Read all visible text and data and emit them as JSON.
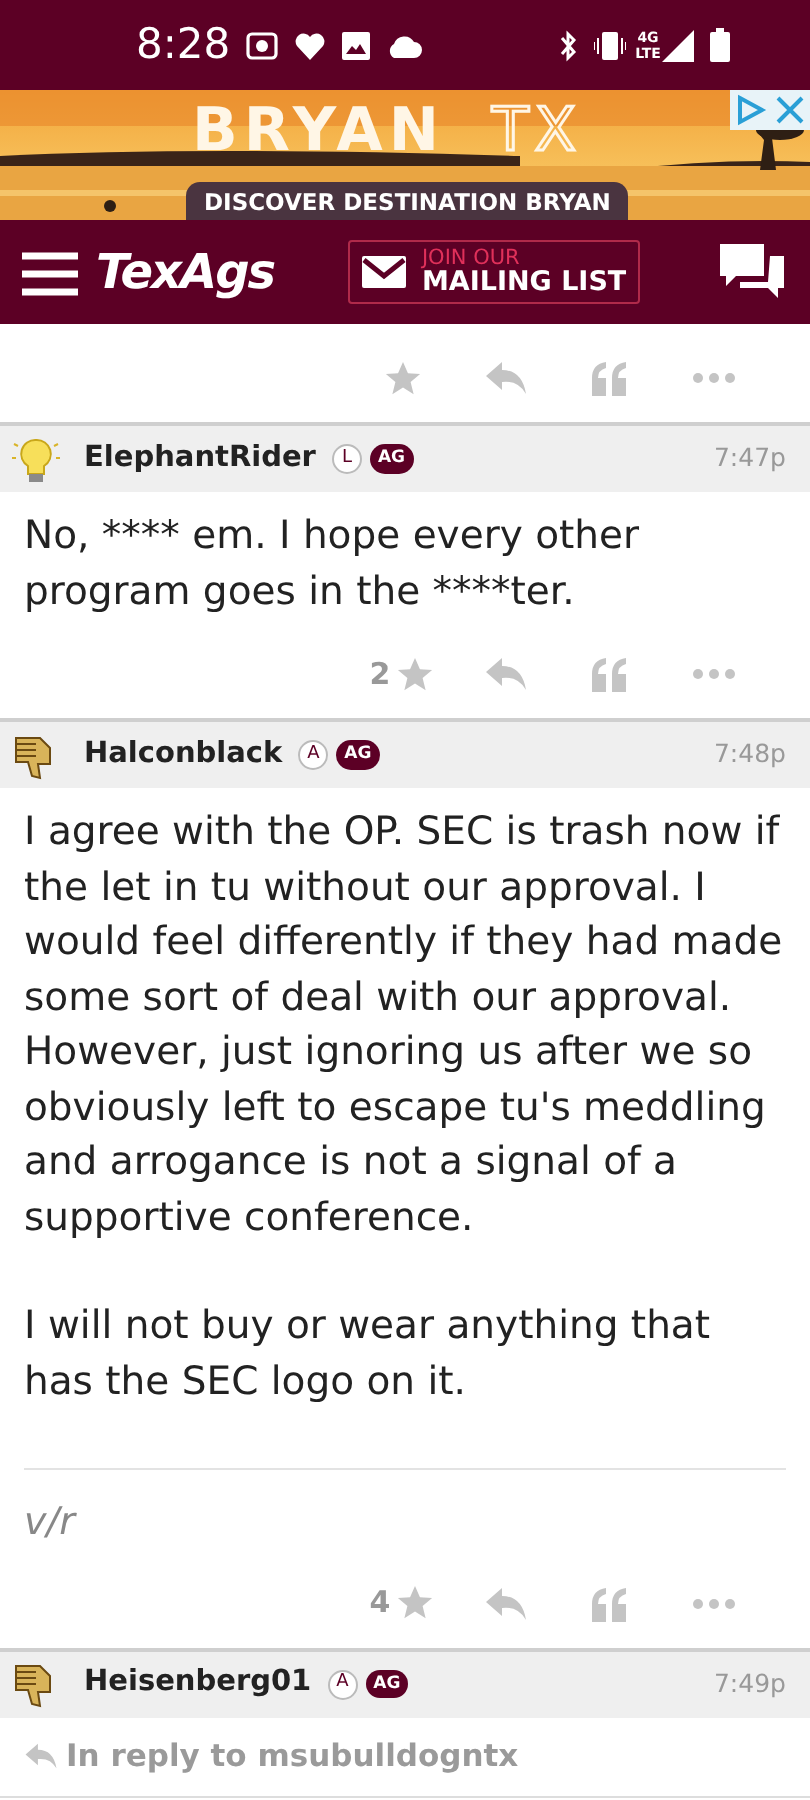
{
  "status_bar": {
    "time": "8:28",
    "network": "4G LTE"
  },
  "ad": {
    "headline": "BRYAN",
    "headline_suffix": "TX",
    "tagline": "DISCOVER DESTINATION BRYAN"
  },
  "navbar": {
    "logo": "TexAgs",
    "mailing_top": "JOIN OUR",
    "mailing_bottom": "MAILING LIST"
  },
  "posts": [
    {
      "username": "ElephantRider",
      "avatar": {
        "kind": "lightbulb"
      },
      "badges": [
        {
          "label": "L",
          "kind": "rank"
        },
        {
          "label": "AG",
          "kind": "school"
        }
      ],
      "time": "7:47p",
      "paragraphs": [
        "No, **** em. I hope every other program goes in the ****ter."
      ],
      "star_count": "2"
    },
    {
      "username": "Halconblack",
      "avatar": {
        "kind": "thumbsdown"
      },
      "badges": [
        {
          "label": "A",
          "kind": "rank"
        },
        {
          "label": "AG",
          "kind": "school"
        }
      ],
      "time": "7:48p",
      "paragraphs": [
        "I agree with the OP. SEC is trash now if the let in tu without our approval. I would feel differently if they had made some sort of deal with our approval. However, just ignoring us after we so obviously left to escape tu's meddling and arrogance is not a signal of a supportive conference.",
        "I will not buy or wear anything that has the SEC logo on it."
      ],
      "signature": "v/r",
      "star_count": "4"
    },
    {
      "username": "Heisenberg01",
      "avatar": {
        "kind": "thumbsdown"
      },
      "badges": [
        {
          "label": "A",
          "kind": "rank"
        },
        {
          "label": "AG",
          "kind": "school"
        }
      ],
      "time": "7:49p",
      "reply_to": "In reply to msubulldogntx"
    }
  ]
}
